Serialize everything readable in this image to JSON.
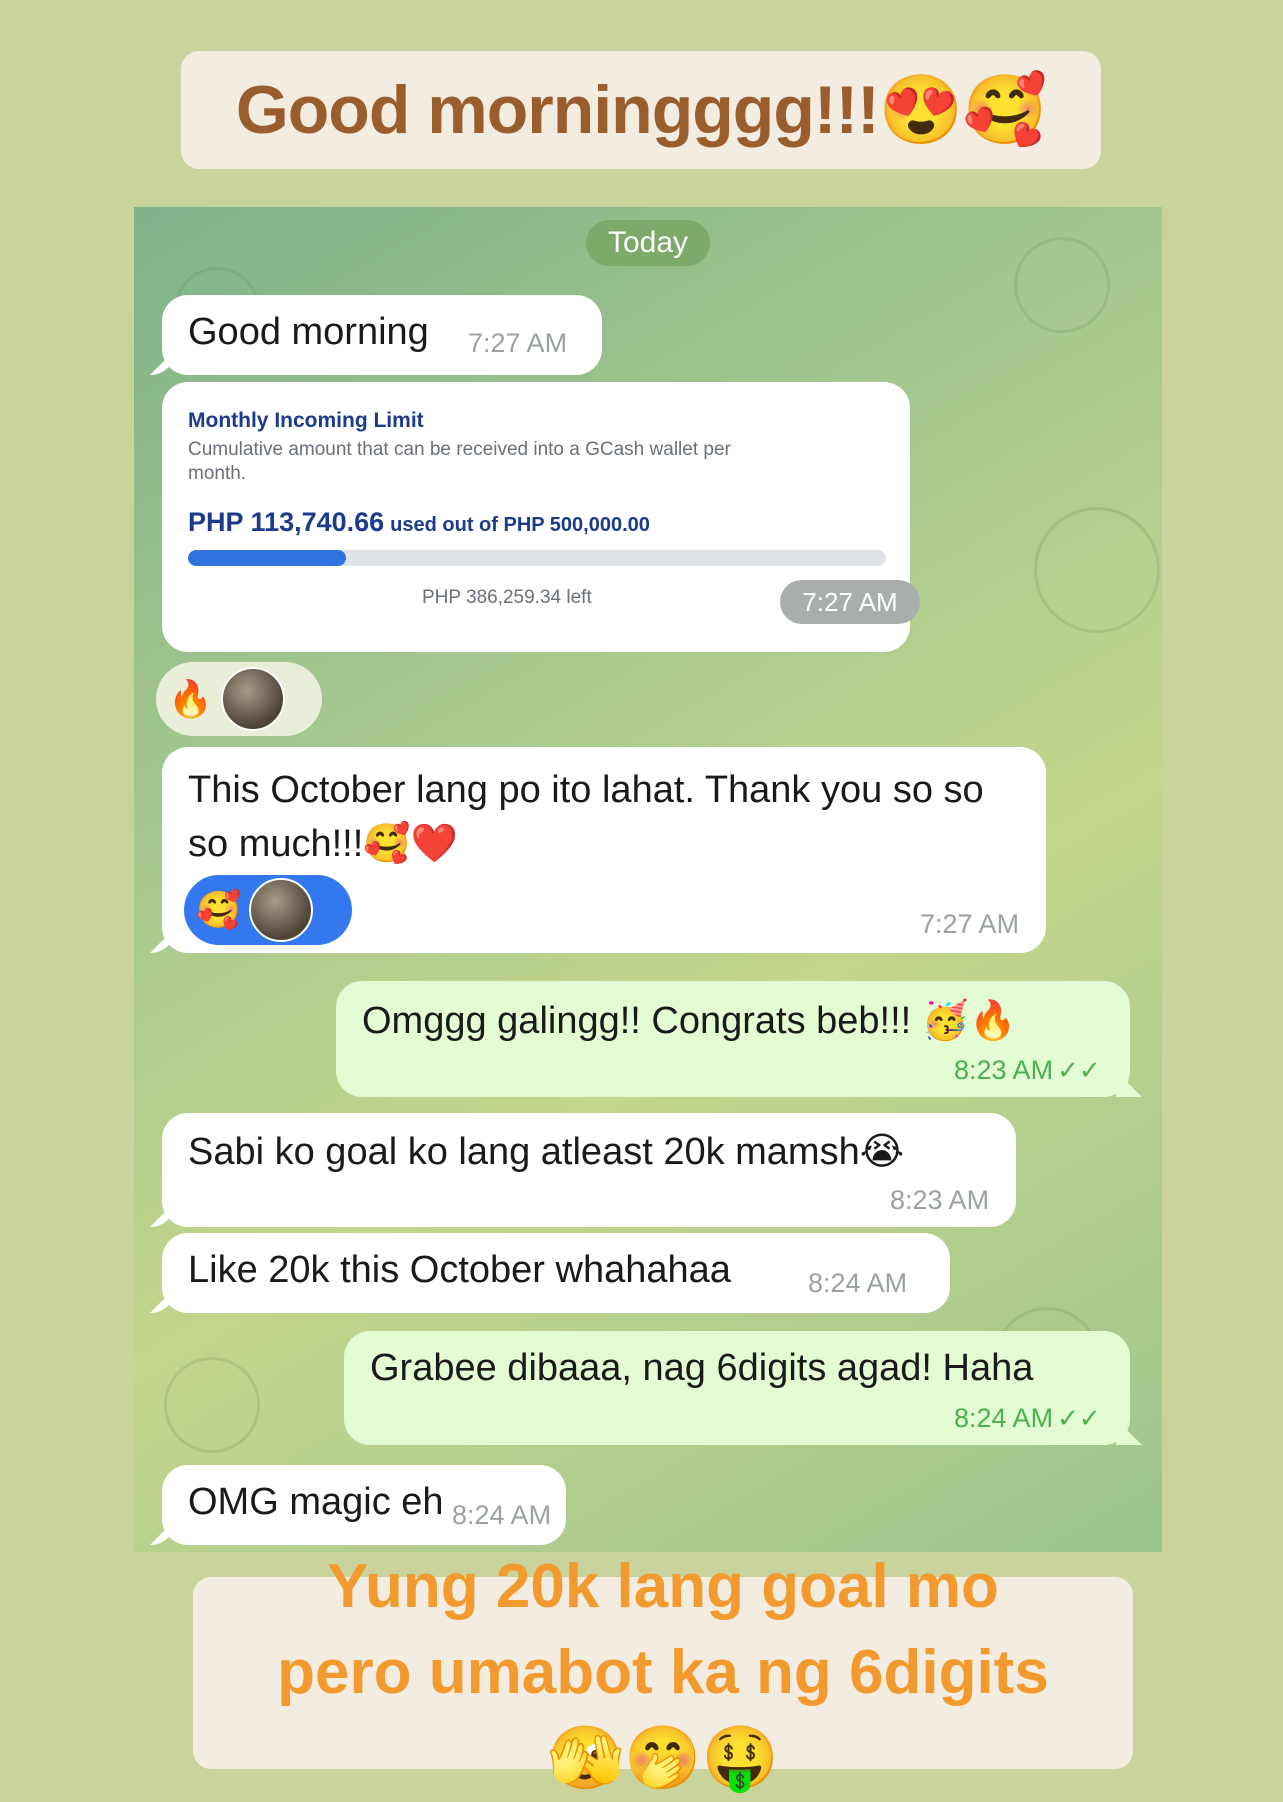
{
  "top_caption": "Good morningggg!!!😍🥰",
  "date_label": "Today",
  "messages": [
    {
      "text": "Good morning",
      "time": "7:27 AM"
    },
    {
      "text": "This October lang po ito lahat. Thank you so so so much!!!🥰❤️",
      "time": "7:27 AM"
    },
    {
      "text": "Omggg galingg!! Congrats beb!!! 🥳🔥",
      "time": "8:23 AM"
    },
    {
      "text": "Sabi ko goal ko lang atleast 20k mamsh😭",
      "time": "8:23 AM"
    },
    {
      "text": "Like 20k this October whahahaa",
      "time": "8:24 AM"
    },
    {
      "text": "Grabee dibaaa, nag 6digits agad! Haha",
      "time": "8:24 AM"
    },
    {
      "text": "OMG magic eh",
      "time": "8:24 AM"
    }
  ],
  "card": {
    "title": "Monthly Incoming Limit",
    "description": "Cumulative amount that can be received into a GCash wallet per month.",
    "amount": "PHP 113,740.66",
    "used_text": "used out of PHP 500,000.00",
    "progress_fraction": 0.227,
    "left_text": "PHP 386,259.34 left",
    "time": "7:27 AM"
  },
  "reactions": {
    "first": "🔥",
    "second": "🥰"
  },
  "read_checks": "✓✓",
  "bottom_caption": "Yung 20k lang goal mo pero umabot ka ng 6digits 🫣🤭🤑",
  "colors": {
    "outgoing_bubble": "#e4fcd4",
    "accent_blue": "#2f73e0",
    "caption_orange": "#f29a2e",
    "caption_brown": "#9a5e2e"
  }
}
